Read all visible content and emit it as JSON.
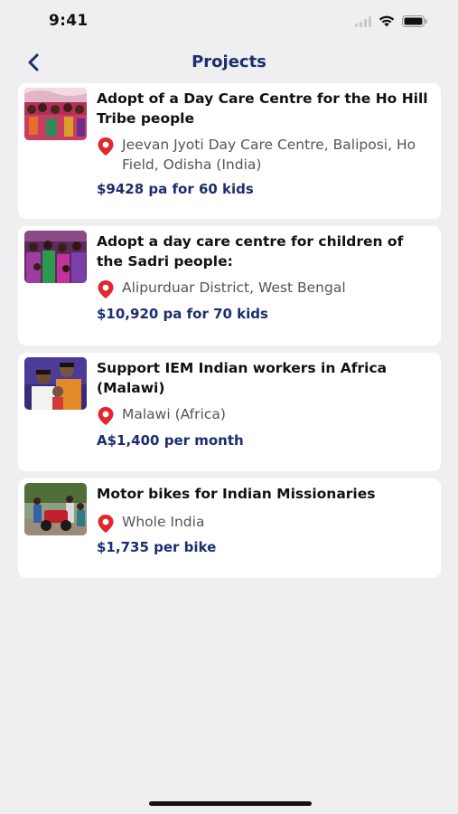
{
  "status": {
    "time": "9:41"
  },
  "header": {
    "title": "Projects"
  },
  "projects": [
    {
      "title": "Adopt of a Day Care Centre for the Ho Hill Tribe people",
      "location": "Jeevan Jyoti Day Care Centre, Baliposi, Ho Field, Odisha (India)",
      "price": "$9428 pa for 60 kids"
    },
    {
      "title": "Adopt a day care centre for children of the Sadri people:",
      "location": "Alipurduar District, West Bengal",
      "price": "$10,920 pa for 70 kids"
    },
    {
      "title": "Support IEM Indian workers in Africa (Malawi)",
      "location": "Malawi (Africa)",
      "price": "A$1,400 per month"
    },
    {
      "title": "Motor bikes for Indian Missionaries",
      "location": "Whole India",
      "price": "$1,735 per bike"
    }
  ],
  "colors": {
    "accent": "#1b2f6e",
    "pin": "#e1262d",
    "background": "#efeff1"
  }
}
